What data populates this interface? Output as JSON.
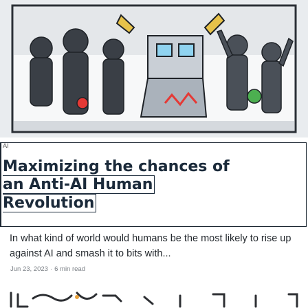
{
  "post": {
    "tag": "AI",
    "title_line1": "Maximizing the chances of",
    "title_line2": "an Anti-AI Human",
    "title_line3": "Revolution",
    "summary": "In what kind of world would humans be the most likely to rise up against AI and smash it to bits with...",
    "date": "Jun 23, 2023",
    "separator": "·",
    "read_time": "6 min read"
  },
  "colors": {
    "title": "#1b2a3a",
    "body_text": "#23282d",
    "meta_text": "#7a7f85",
    "card_border": "#1a2530"
  },
  "icons": {
    "hero": "comic-illustration",
    "next": "comic-strip-preview"
  }
}
